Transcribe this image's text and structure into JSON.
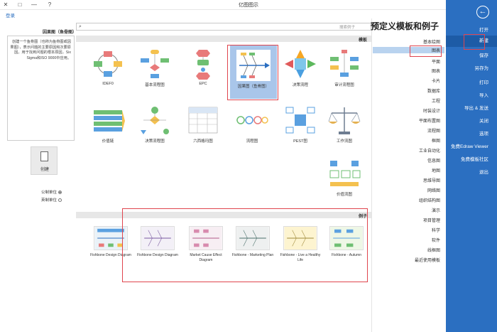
{
  "window": {
    "title": "亿图图示",
    "help": "?",
    "minimize": "—",
    "maximize": "□",
    "close": "✕"
  },
  "login": "登录",
  "nav": {
    "back": "←",
    "items": [
      "打开",
      "新建",
      "保存",
      "另存为",
      "打印",
      "导入",
      "导出 & 发送",
      "关闭",
      "选项",
      "免费Edraw Viewer",
      "免费模板社区",
      "退出"
    ]
  },
  "categories": {
    "title": "预定义模板和例子",
    "items": [
      "基本绘图",
      "图表",
      "平面",
      "图表",
      "卡片",
      "数据库",
      "工程",
      "时装设计",
      "平面布置图",
      "流程图",
      "框图",
      "工业自动化",
      "信息图",
      "地图",
      "思维导图",
      "网络图",
      "组织结构图",
      "演示",
      "项目管理",
      "科学",
      "软件",
      "线框图",
      "最近使用模板"
    ],
    "selected_index": 1
  },
  "search": {
    "placeholder": "搜索例子"
  },
  "sections": {
    "templates": "模板",
    "examples": "例子"
  },
  "templates": [
    {
      "label": "审计流程图",
      "icon": "audit-flowchart-icon"
    },
    {
      "label": "决策流程",
      "icon": "cause-effect-icon"
    },
    {
      "label": "因果图（鱼骨图）",
      "icon": "fishbone-diagram-icon"
    },
    {
      "label": "EPC",
      "icon": "epc-diagram-icon"
    },
    {
      "label": "基本流程图",
      "icon": "basic-flowchart-icon"
    },
    {
      "label": "IDEF0",
      "icon": "idef0-icon"
    },
    {
      "label": "工作流图",
      "icon": "workflow-icon"
    },
    {
      "label": "PEST图",
      "icon": "pest-diagram-icon"
    },
    {
      "label": "流程图",
      "icon": "process-diagram-icon"
    },
    {
      "label": "六西格玛图",
      "icon": "six-sigma-icon"
    },
    {
      "label": "决策流程图",
      "icon": "decision-flowchart-icon"
    },
    {
      "label": "价值链",
      "icon": "value-chain-icon"
    },
    {
      "label": "价值流图",
      "icon": "value-stream-icon"
    }
  ],
  "examples": [
    {
      "label": "Fishbone - Autumn",
      "icon": "fishbone-autumn-thumb"
    },
    {
      "label": "Fishbone - Live a Healthy Life",
      "icon": "fishbone-healthy-thumb"
    },
    {
      "label": "Fishbone - Marketing Plan",
      "icon": "fishbone-marketing-thumb"
    },
    {
      "label": "Market Cause Effect Diagram",
      "icon": "market-cause-thumb"
    },
    {
      "label": "Fishbone Design Diagram",
      "icon": "fishbone-design-thumb"
    },
    {
      "label": "Fishbone Design Diagram",
      "icon": "fishbone-design2-thumb"
    }
  ],
  "preview": {
    "title": "因果图（鱼骨图）",
    "description": "创建一个鱼骨图（也称为鱼骨图或因果图），表示问题的主要原因和次要原因。用于找到问题的根本原因，Six Sigma和ISO 9000中应用。"
  },
  "new_button": "创建",
  "units": {
    "metric": "公制单位",
    "imperial": "英制单位"
  },
  "colors": {
    "nav_bg": "#2b6fc1",
    "selected": "#b9d3ef",
    "highlight": "#e0454e"
  }
}
